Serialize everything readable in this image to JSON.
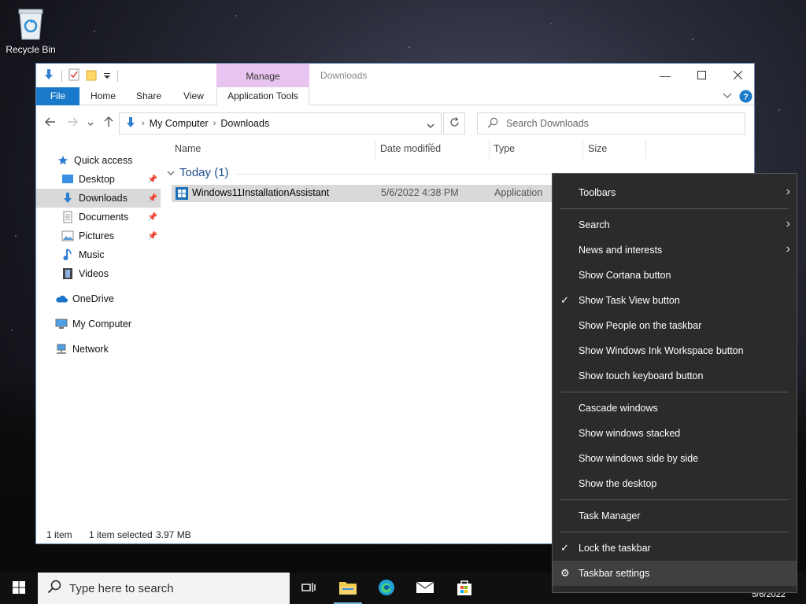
{
  "desktop": {
    "recycle_bin_label": "Recycle Bin"
  },
  "explorer": {
    "title": "Downloads",
    "manage_tab": "Manage",
    "ribbon_tabs": [
      "File",
      "Home",
      "Share",
      "View",
      "Application Tools"
    ],
    "address": {
      "segments": [
        "My Computer",
        "Downloads"
      ]
    },
    "search_placeholder": "Search Downloads",
    "nav": {
      "quick_access": "Quick access",
      "desktop": "Desktop",
      "downloads": "Downloads",
      "documents": "Documents",
      "pictures": "Pictures",
      "music": "Music",
      "videos": "Videos",
      "onedrive": "OneDrive",
      "my_computer": "My Computer",
      "network": "Network"
    },
    "columns": {
      "name": "Name",
      "date_modified": "Date modified",
      "type": "Type",
      "size": "Size"
    },
    "group_label": "Today (1)",
    "files": [
      {
        "name": "Windows11InstallationAssistant",
        "date_modified": "5/6/2022 4:38 PM",
        "type": "Application"
      }
    ],
    "status": {
      "item_count": "1 item",
      "selection": "1 item selected",
      "size": "3.97 MB"
    }
  },
  "context_menu": {
    "toolbars": "Toolbars",
    "search": "Search",
    "news": "News and interests",
    "cortana": "Show Cortana button",
    "task_view": "Show Task View button",
    "people": "Show People on the taskbar",
    "ink": "Show Windows Ink Workspace button",
    "touch_kb": "Show touch keyboard button",
    "cascade": "Cascade windows",
    "stacked": "Show windows stacked",
    "side_by_side": "Show windows side by side",
    "show_desktop": "Show the desktop",
    "task_manager": "Task Manager",
    "lock": "Lock the taskbar",
    "settings": "Taskbar settings"
  },
  "taskbar": {
    "search_placeholder": "Type here to search",
    "date": "5/6/2022"
  },
  "colors": {
    "accent": "#1979ca",
    "manage_tab": "#e8c5f0",
    "menu_bg": "#2b2b2b"
  }
}
